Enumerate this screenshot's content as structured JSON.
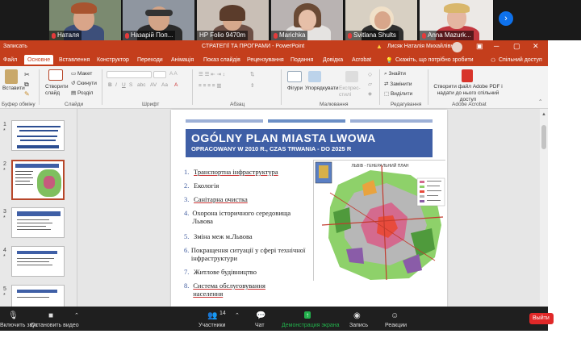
{
  "video_strip": {
    "participants": [
      {
        "name": "Наталя"
      },
      {
        "name": "Назарій Поп..."
      },
      {
        "name": "HP Folio 9470m"
      },
      {
        "name": "Marichka"
      },
      {
        "name": "Svitlana Shults"
      },
      {
        "name": "Anna Mazurk..."
      }
    ],
    "next_icon": "chevron-right-icon"
  },
  "window": {
    "save_label": "Записать",
    "title": "СТРАТЕГІЇ ТА ПРОГРАМИ  -  PowerPoint",
    "user": "Лисяк Наталія Михайлівна",
    "warning_icon": "warning-icon"
  },
  "tabs": [
    "Файл",
    "Основне",
    "Вставлення",
    "Конструктор",
    "Переходи",
    "Анімація",
    "Показ слайдів",
    "Рецензування",
    "Подання",
    "Довідка",
    "Acrobat"
  ],
  "tell_me": "Скажіть, що потрібно зробити",
  "share_label": "Спільний доступ",
  "ribbon": {
    "paste": "Вставити",
    "clipboard": "Буфер обміну",
    "new_slide": "Створити слайд",
    "layout": "Макет",
    "reset": "Скинути",
    "section": "Розділ",
    "slides": "Слайди",
    "font": "Шрифт",
    "paragraph": "Абзац",
    "shapes": "Фігури",
    "arrange": "Упорядкувати",
    "quick_styles": "Експрес-стилі",
    "drawing": "Малювання",
    "find": "Знайти",
    "replace": "Замінити",
    "select": "Виділити",
    "editing": "Редагування",
    "adobe_btn": "Створити файл Adobe PDF і надати до нього спільний доступ",
    "adobe_group": "Adobe Acrobat"
  },
  "thumbnails": [
    {
      "num": "1",
      "star": "*"
    },
    {
      "num": "2",
      "star": "*"
    },
    {
      "num": "3",
      "star": "*"
    },
    {
      "num": "4",
      "star": "*"
    },
    {
      "num": "5",
      "star": "*"
    }
  ],
  "slide": {
    "title": "OGÓLNY PLAN MIASTA LWOWA",
    "subtitle": "OPRACOWANY W 2010 R., CZAS TRWANIA - DO 2025 R",
    "items": [
      {
        "n": "1.",
        "text": "Транспортна інфраструктура"
      },
      {
        "n": "2.",
        "text": "Екологія"
      },
      {
        "n": "3.",
        "text": "Санітарна очистка"
      },
      {
        "n": "4.",
        "text": "Охорона   історичного середовища Львова"
      },
      {
        "n": "5.",
        "text": "Зміна меж м.Львова"
      },
      {
        "n": "6.",
        "text": "Покращення ситуації у сфері технічної інфраструктури"
      },
      {
        "n": "7.",
        "text": "Житлове будівництво"
      },
      {
        "n": "8.",
        "text": "Система обслуговування населення"
      }
    ],
    "map_header": "ЛЬВІВ - ГЕНЕРАЛЬНИЙ ПЛАН"
  },
  "zoom_toolbar": {
    "mute": "Включить звук",
    "video": "Остановить видео",
    "participants": "Участники",
    "participants_count": "14",
    "chat": "Чат",
    "share": "Демонстрация экрана",
    "record": "Запись",
    "reactions": "Реакции",
    "end": "Выйти"
  }
}
